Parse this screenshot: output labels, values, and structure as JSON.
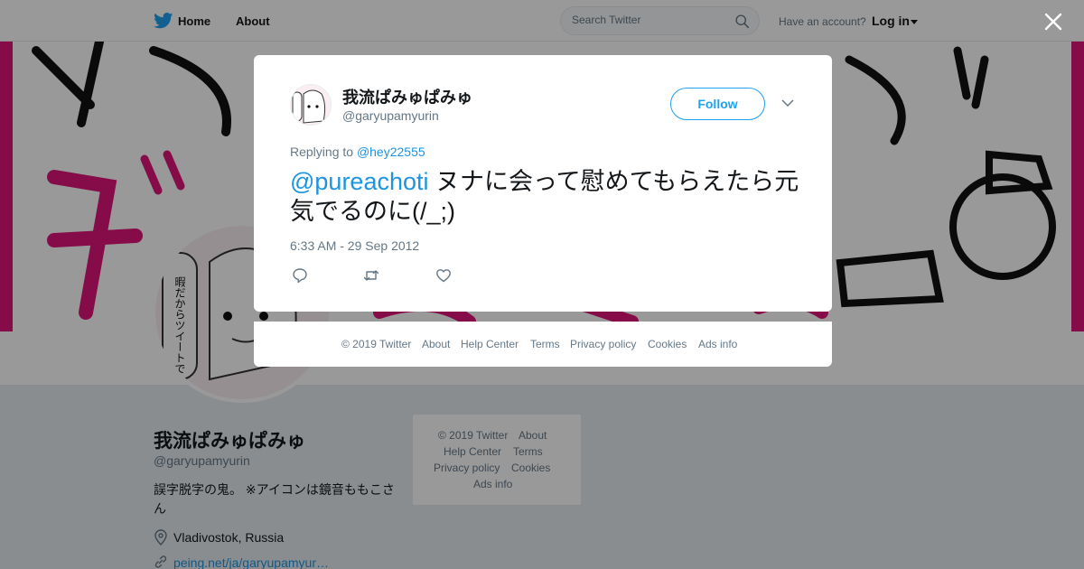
{
  "nav": {
    "home": "Home",
    "about": "About",
    "search_placeholder": "Search Twitter",
    "have_account": "Have an account?",
    "login": "Log in"
  },
  "colors": {
    "brand": "#1da1f2",
    "link": "#1b95e0",
    "banner_pink": "#e0157a"
  },
  "profile": {
    "name": "我流ぱみゅぱみゅ",
    "handle": "@garyupamyurin",
    "bio": "誤字脱字の鬼。 ※アイコンは鏡音ももこさん",
    "location": "Vladivostok, Russia",
    "website": "peing.net/ja/garyupamyur…",
    "avatar_caption": "暇だからツイートでもTLに流すか不穏"
  },
  "page_footer": {
    "copyright": "© 2019 Twitter",
    "about": "About",
    "help": "Help Center",
    "terms": "Terms",
    "privacy": "Privacy policy",
    "cookies": "Cookies",
    "ads": "Ads info"
  },
  "tweet": {
    "author_name": "我流ぱみゅぱみゅ",
    "author_handle": "@garyupamyurin",
    "follow_label": "Follow",
    "replying_prefix": "Replying to",
    "replying_to": "@hey22555",
    "mention": "@pureachoti",
    "text": " ヌナに会って慰めてもらえたら元気でるのに(/_;)",
    "timestamp": "6:33 AM - 29 Sep 2012",
    "actions": [
      "reply-icon",
      "retweet-icon",
      "like-icon"
    ]
  },
  "modal_footer": {
    "copyright": "© 2019 Twitter",
    "about": "About",
    "help": "Help Center",
    "terms": "Terms",
    "privacy": "Privacy policy",
    "cookies": "Cookies",
    "ads": "Ads info"
  }
}
